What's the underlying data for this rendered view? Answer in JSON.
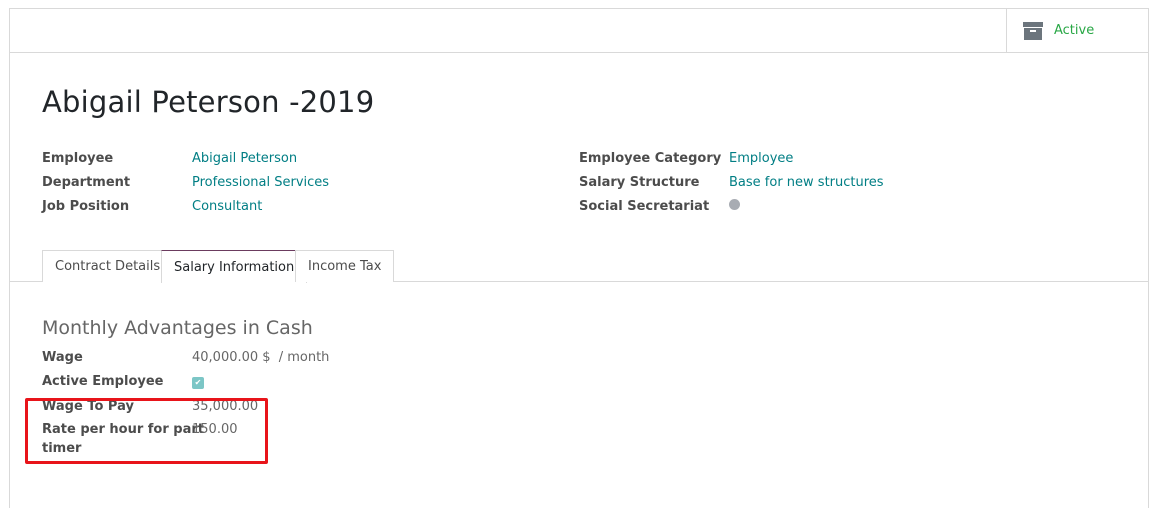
{
  "status": {
    "label": "Active",
    "icon": "archive-icon"
  },
  "record": {
    "title": "Abigail Peterson -2019"
  },
  "fields_left": [
    {
      "label": "Employee",
      "value": "Abigail Peterson"
    },
    {
      "label": "Department",
      "value": "Professional Services"
    },
    {
      "label": "Job Position",
      "value": "Consultant"
    }
  ],
  "fields_right": [
    {
      "label": "Employee Category",
      "value": "Employee"
    },
    {
      "label": "Salary Structure",
      "value": "Base for new structures"
    },
    {
      "label": "Social Secretariat",
      "value": ""
    }
  ],
  "tabs": [
    {
      "label": "Contract Details",
      "active": false
    },
    {
      "label": "Salary Information",
      "active": true
    },
    {
      "label": "Income Tax",
      "active": false
    }
  ],
  "section": {
    "title": "Monthly Advantages in Cash",
    "wage": {
      "label": "Wage",
      "value": "40,000.00 $",
      "unit": "/ month"
    },
    "active_employee": {
      "label": "Active Employee",
      "checked": true
    },
    "wage_to_pay": {
      "label": "Wage To Pay",
      "value": "35,000.00"
    },
    "rate_part_timer": {
      "label_line1": "Rate per hour for part",
      "label_line2": "timer",
      "value": "150.00"
    }
  },
  "colors": {
    "link": "#017e84",
    "active_status": "#28a745",
    "highlight": "#e8141a"
  }
}
